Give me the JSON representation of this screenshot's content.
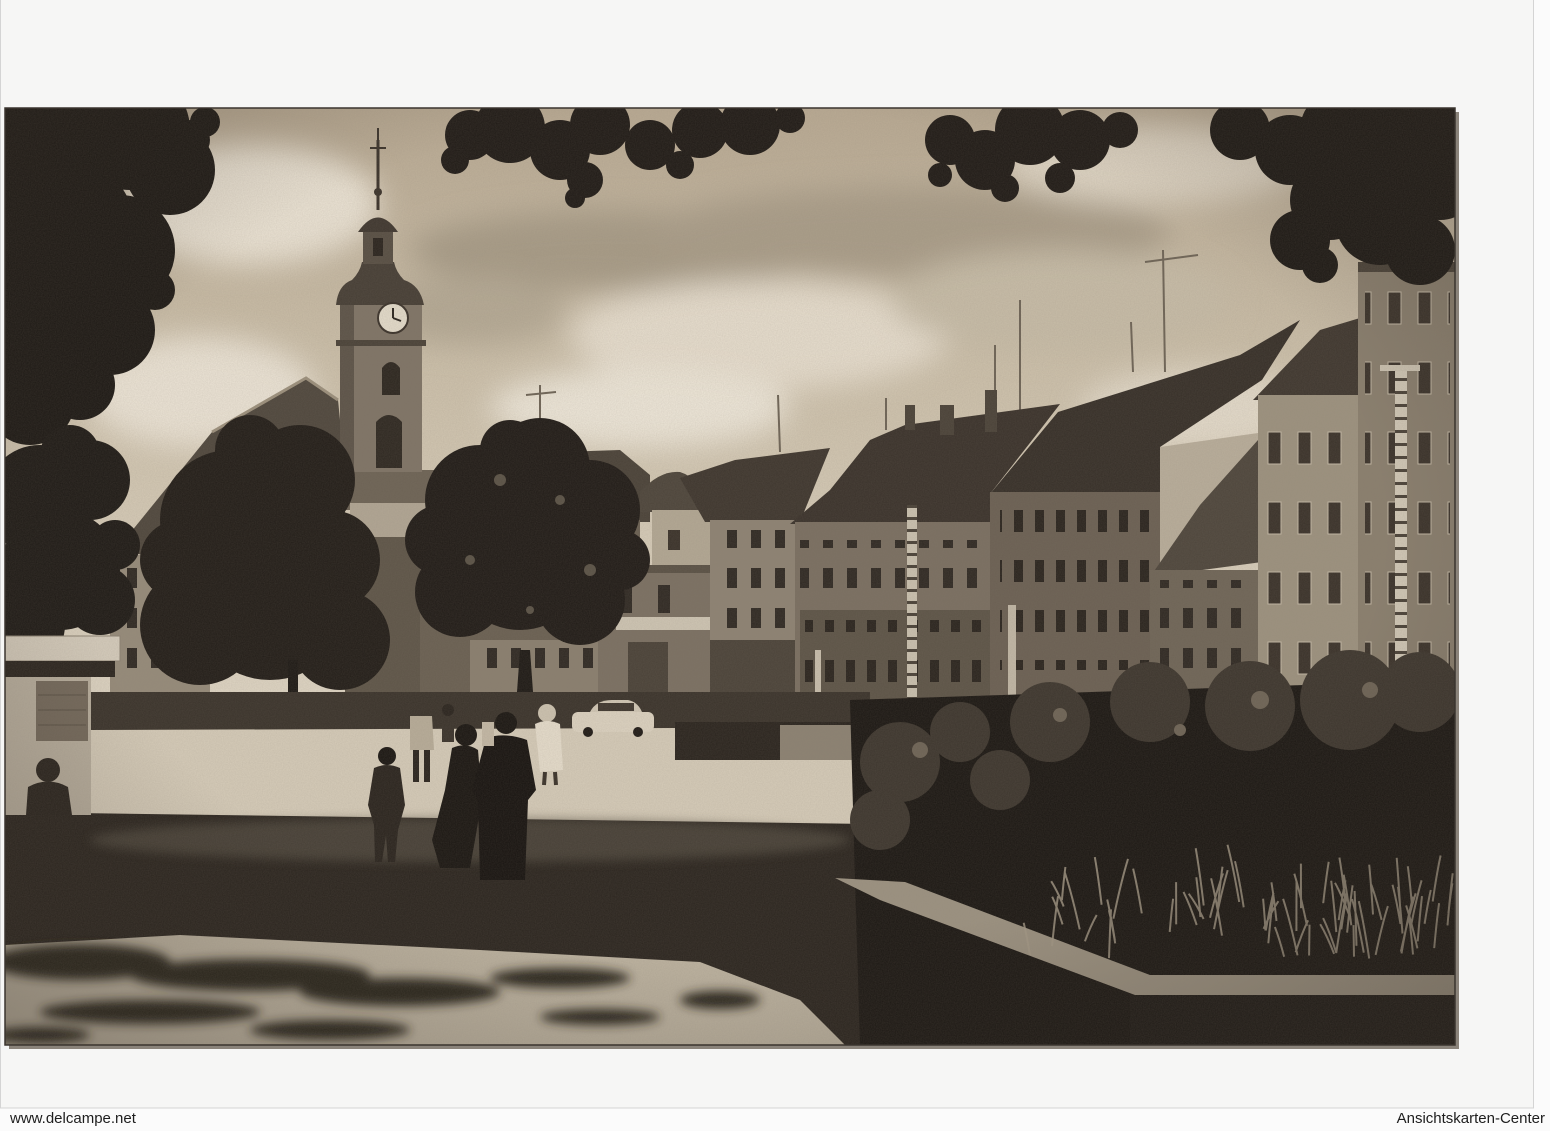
{
  "watermarks": {
    "left": "www.delcampe.net",
    "right": "Ansichtskarten-Center"
  },
  "colors": {
    "page_background": "#fbfbfb",
    "watermark_text": "#1e1e1e"
  }
}
